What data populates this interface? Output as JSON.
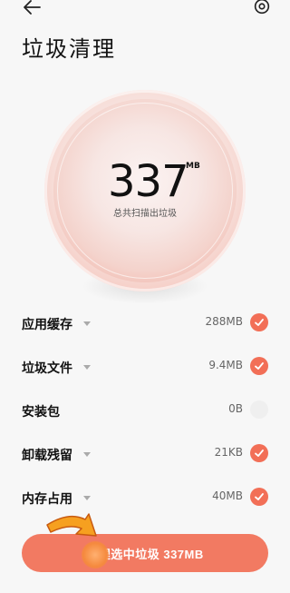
{
  "header": {
    "title": "垃圾清理",
    "back_icon": "back-arrow-icon",
    "settings_icon": "gear-icon"
  },
  "summary": {
    "number": "337",
    "unit": "MB",
    "caption": "总共扫描出垃圾"
  },
  "items": [
    {
      "label": "应用缓存",
      "size": "288MB",
      "checked": true
    },
    {
      "label": "垃圾文件",
      "size": "9.4MB",
      "checked": true
    },
    {
      "label": "安装包",
      "size": "0B",
      "checked": false
    },
    {
      "label": "卸载残留",
      "size": "21KB",
      "checked": true
    },
    {
      "label": "内存占用",
      "size": "40MB",
      "checked": true
    }
  ],
  "action": {
    "clean_label": "清理选中垃圾 337MB"
  },
  "colors": {
    "accent": "#f27a62",
    "check_on": "#f26f57",
    "check_off": "#efefef"
  }
}
